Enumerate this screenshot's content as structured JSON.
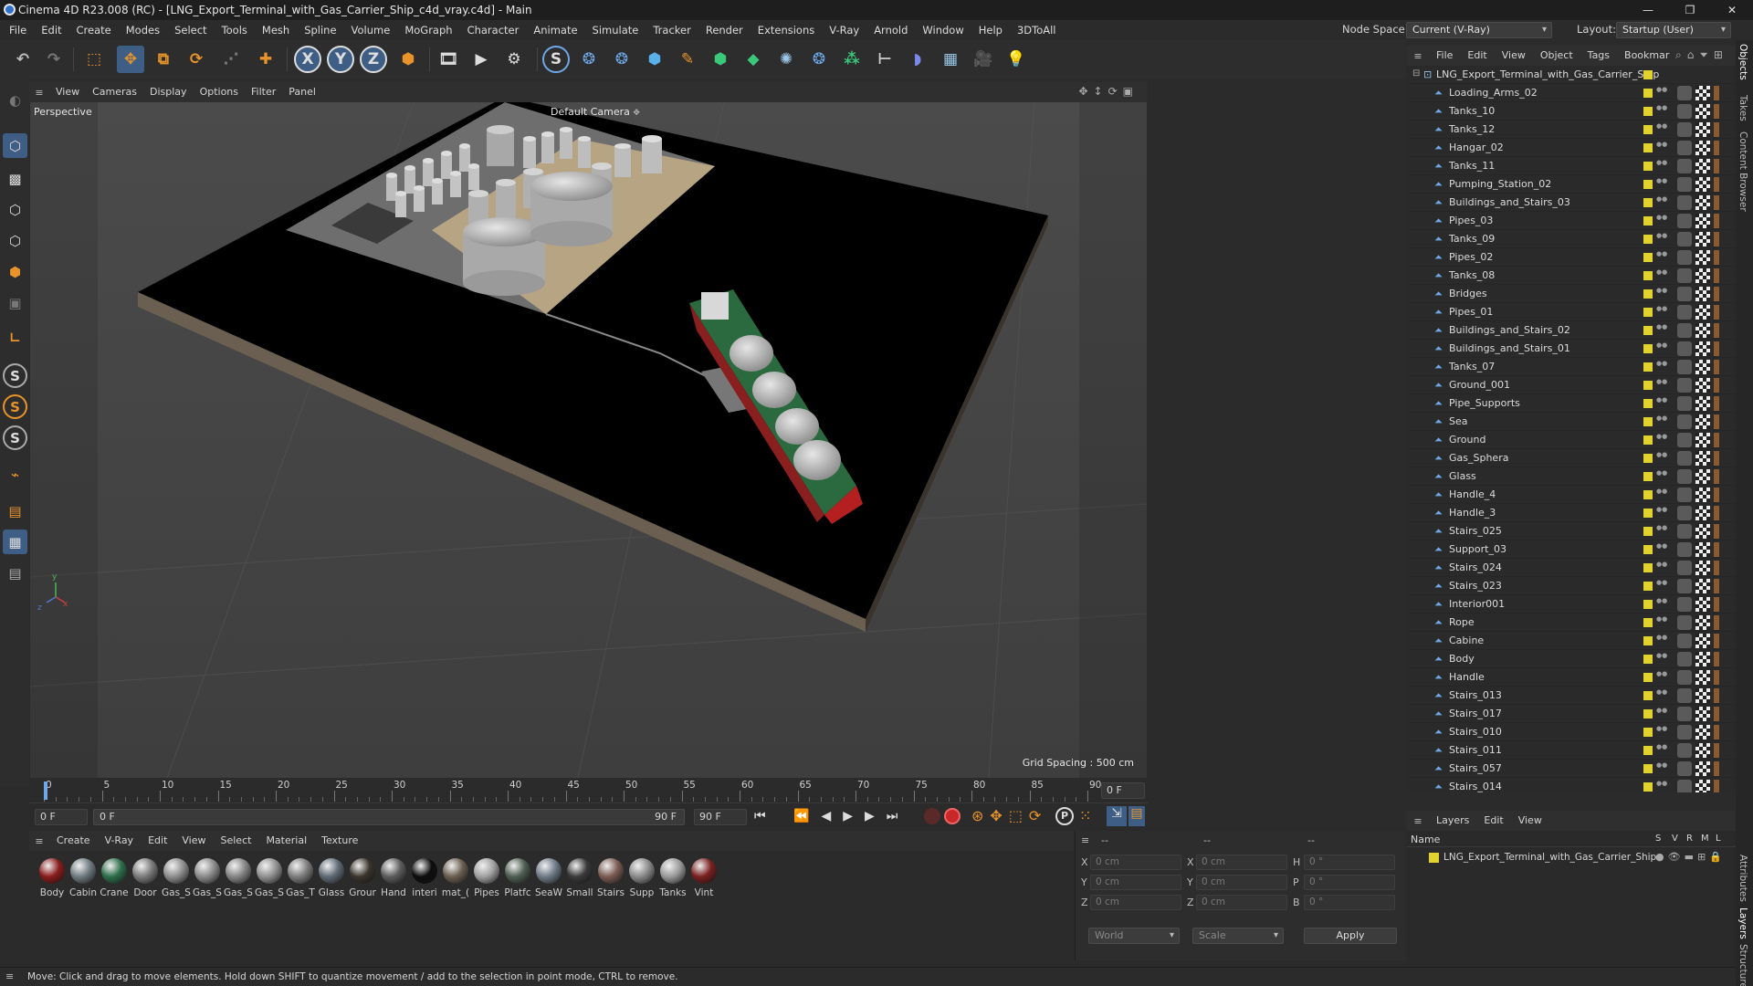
{
  "window": {
    "title": "Cinema 4D R23.008 (RC) - [LNG_Export_Terminal_with_Gas_Carrier_Ship_c4d_vray.c4d] - Main",
    "minimize": "—",
    "maximize": "❐",
    "close": "✕"
  },
  "menubar": {
    "items": [
      "File",
      "Edit",
      "Create",
      "Modes",
      "Select",
      "Tools",
      "Mesh",
      "Spline",
      "Volume",
      "MoGraph",
      "Character",
      "Animate",
      "Simulate",
      "Tracker",
      "Render",
      "Extensions",
      "V-Ray",
      "Arnold",
      "Window",
      "Help",
      "3DToAll"
    ],
    "node_space_label": "Node Space:",
    "node_space_value": "Current (V-Ray)",
    "layout_label": "Layout:",
    "layout_value": "Startup (User)"
  },
  "viewport": {
    "menu": [
      "View",
      "Cameras",
      "Display",
      "Options",
      "Filter",
      "Panel"
    ],
    "projection_label": "Perspective",
    "camera_label": "Default Camera",
    "grid_spacing": "Grid Spacing : 500 cm"
  },
  "timeline": {
    "ticks": [
      "0",
      "5",
      "10",
      "15",
      "20",
      "25",
      "30",
      "35",
      "40",
      "45",
      "50",
      "55",
      "60",
      "65",
      "70",
      "75",
      "80",
      "85",
      "90"
    ],
    "current_frame_right": "0 F",
    "start_frame": "0 F",
    "preview_start": "0 F",
    "preview_end": "90 F",
    "end_frame": "90 F"
  },
  "material_manager": {
    "menu": [
      "Create",
      "V-Ray",
      "Edit",
      "View",
      "Select",
      "Material",
      "Texture"
    ],
    "materials": [
      {
        "label": "Body",
        "color": "#8a1c1c"
      },
      {
        "label": "Cabin",
        "color": "#6e7a80"
      },
      {
        "label": "Crane",
        "color": "#2d6e4a"
      },
      {
        "label": "Door",
        "color": "#7a7a7a"
      },
      {
        "label": "Gas_S",
        "color": "#8d8d8d"
      },
      {
        "label": "Gas_S",
        "color": "#8a8a8a"
      },
      {
        "label": "Gas_S",
        "color": "#858585"
      },
      {
        "label": "Gas_S",
        "color": "#909090"
      },
      {
        "label": "Gas_T",
        "color": "#7d7d7d"
      },
      {
        "label": "Glass",
        "color": "#5f6a75"
      },
      {
        "label": "Grour",
        "color": "#3b352c"
      },
      {
        "label": "Hand",
        "color": "#5c5c5c"
      },
      {
        "label": "interi",
        "color": "#0d0d0d"
      },
      {
        "label": "mat_(",
        "color": "#6a5e50"
      },
      {
        "label": "Pipes",
        "color": "#a0a0a0"
      },
      {
        "label": "Platfc",
        "color": "#4e5e52"
      },
      {
        "label": "SeaW",
        "color": "#6e7a86"
      },
      {
        "label": "Small",
        "color": "#3a3a3a"
      },
      {
        "label": "Stairs",
        "color": "#7a5a52"
      },
      {
        "label": "Supp",
        "color": "#8a8a8a"
      },
      {
        "label": "Tanks",
        "color": "#9a9a9a"
      },
      {
        "label": "Vint",
        "color": "#7a2020"
      }
    ]
  },
  "coordinates": {
    "header_a": "--",
    "header_b": "--",
    "header_c": "--",
    "rows": [
      {
        "axis": "X",
        "pos": "0 cm",
        "axis2": "X",
        "size": "0 cm",
        "rot_label": "H",
        "rot": "0 °"
      },
      {
        "axis": "Y",
        "pos": "0 cm",
        "axis2": "Y",
        "size": "0 cm",
        "rot_label": "P",
        "rot": "0 °"
      },
      {
        "axis": "Z",
        "pos": "0 cm",
        "axis2": "Z",
        "size": "0 cm",
        "rot_label": "B",
        "rot": "0 °"
      }
    ],
    "mode_world": "World",
    "mode_scale": "Scale",
    "apply": "Apply"
  },
  "object_manager": {
    "menu": [
      "File",
      "Edit",
      "View",
      "Object",
      "Tags",
      "Bookmar"
    ],
    "root": "LNG_Export_Terminal_with_Gas_Carrier_Ship",
    "objects": [
      "Loading_Arms_02",
      "Tanks_10",
      "Tanks_12",
      "Hangar_02",
      "Tanks_11",
      "Pumping_Station_02",
      "Buildings_and_Stairs_03",
      "Pipes_03",
      "Tanks_09",
      "Pipes_02",
      "Tanks_08",
      "Bridges",
      "Pipes_01",
      "Buildings_and_Stairs_02",
      "Buildings_and_Stairs_01",
      "Tanks_07",
      "Ground_001",
      "Pipe_Supports",
      "Sea",
      "Ground",
      "Gas_Sphera",
      "Glass",
      "Handle_4",
      "Handle_3",
      "Stairs_025",
      "Support_03",
      "Stairs_024",
      "Stairs_023",
      "Interior001",
      "Rope",
      "Cabine",
      "Body",
      "Handle",
      "Stairs_013",
      "Stairs_017",
      "Stairs_010",
      "Stairs_011",
      "Stairs_057",
      "Stairs_014"
    ]
  },
  "right_tabs": [
    "Objects",
    "Takes",
    "Content Browser",
    "Attributes",
    "Layers",
    "Structure"
  ],
  "layers_manager": {
    "menu": [
      "Layers",
      "Edit",
      "View"
    ],
    "col_name": "Name",
    "cols": [
      "S",
      "V",
      "R",
      "M",
      "L"
    ],
    "layer_name": "LNG_Export_Terminal_with_Gas_Carrier_Ship"
  },
  "status": "Move: Click and drag to move elements. Hold down SHIFT to quantize movement / add to the selection in point mode, CTRL to remove.",
  "colors": {
    "accent_orange": "#e8942a",
    "layer_yellow": "#e1d22e",
    "object_blue": "#6ea8e8"
  }
}
